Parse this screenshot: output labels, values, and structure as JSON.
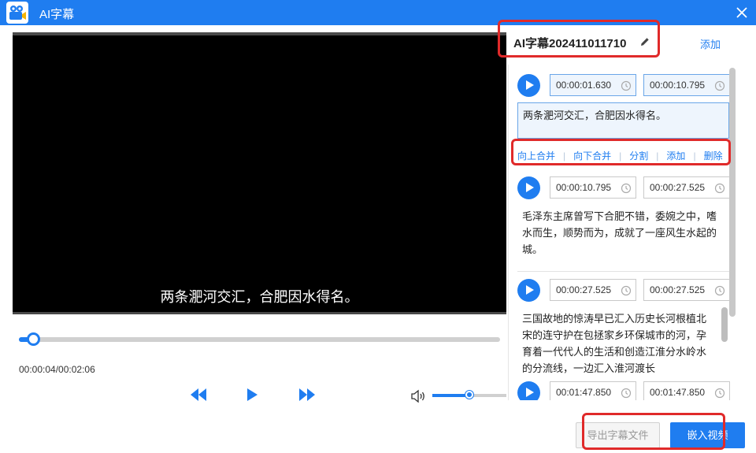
{
  "window": {
    "title": "AI字幕",
    "close_icon": "close-icon",
    "logo_icon": "camera-logo-icon"
  },
  "player": {
    "subtitle_overlay": "两条淝河交汇，合肥因水得名。",
    "time_display": "00:00:04/00:02:06",
    "progress": 0.03,
    "volume": 0.5,
    "controls": [
      "rewind-icon",
      "play-icon",
      "fast-forward-icon",
      "volume-icon"
    ]
  },
  "panel": {
    "file_name": "AI字幕202411011710",
    "add_label": "添加",
    "entries": [
      {
        "start": "00:00:01.630",
        "end": "00:00:10.795",
        "text": "两条淝河交汇，合肥因水得名。",
        "active": true
      },
      {
        "start": "00:00:10.795",
        "end": "00:00:27.525",
        "text": "毛泽东主席曾写下合肥不错，委婉之中，嗜水而生，顺势而为，成就了一座风生水起的城。"
      },
      {
        "start": "00:00:27.525",
        "end": "00:00:27.525",
        "text": "三国故地的惊涛早已汇入历史长河根植北宋的连守护在包拯家乡环保城市的河，孕育着一代代人的生活和创造江淮分水岭水的分流线，一边汇入淮河渡长"
      },
      {
        "start": "00:01:47.850",
        "end": "00:01:47.850",
        "text": ""
      }
    ],
    "actions": {
      "merge_up": "向上合并",
      "merge_down": "向下合并",
      "split": "分割",
      "add": "添加",
      "delete": "删除"
    }
  },
  "footer": {
    "export_label": "导出字幕文件",
    "embed_label": "嵌入视频"
  },
  "colors": {
    "accent": "#1f7df0",
    "highlight": "#e02a2a"
  }
}
